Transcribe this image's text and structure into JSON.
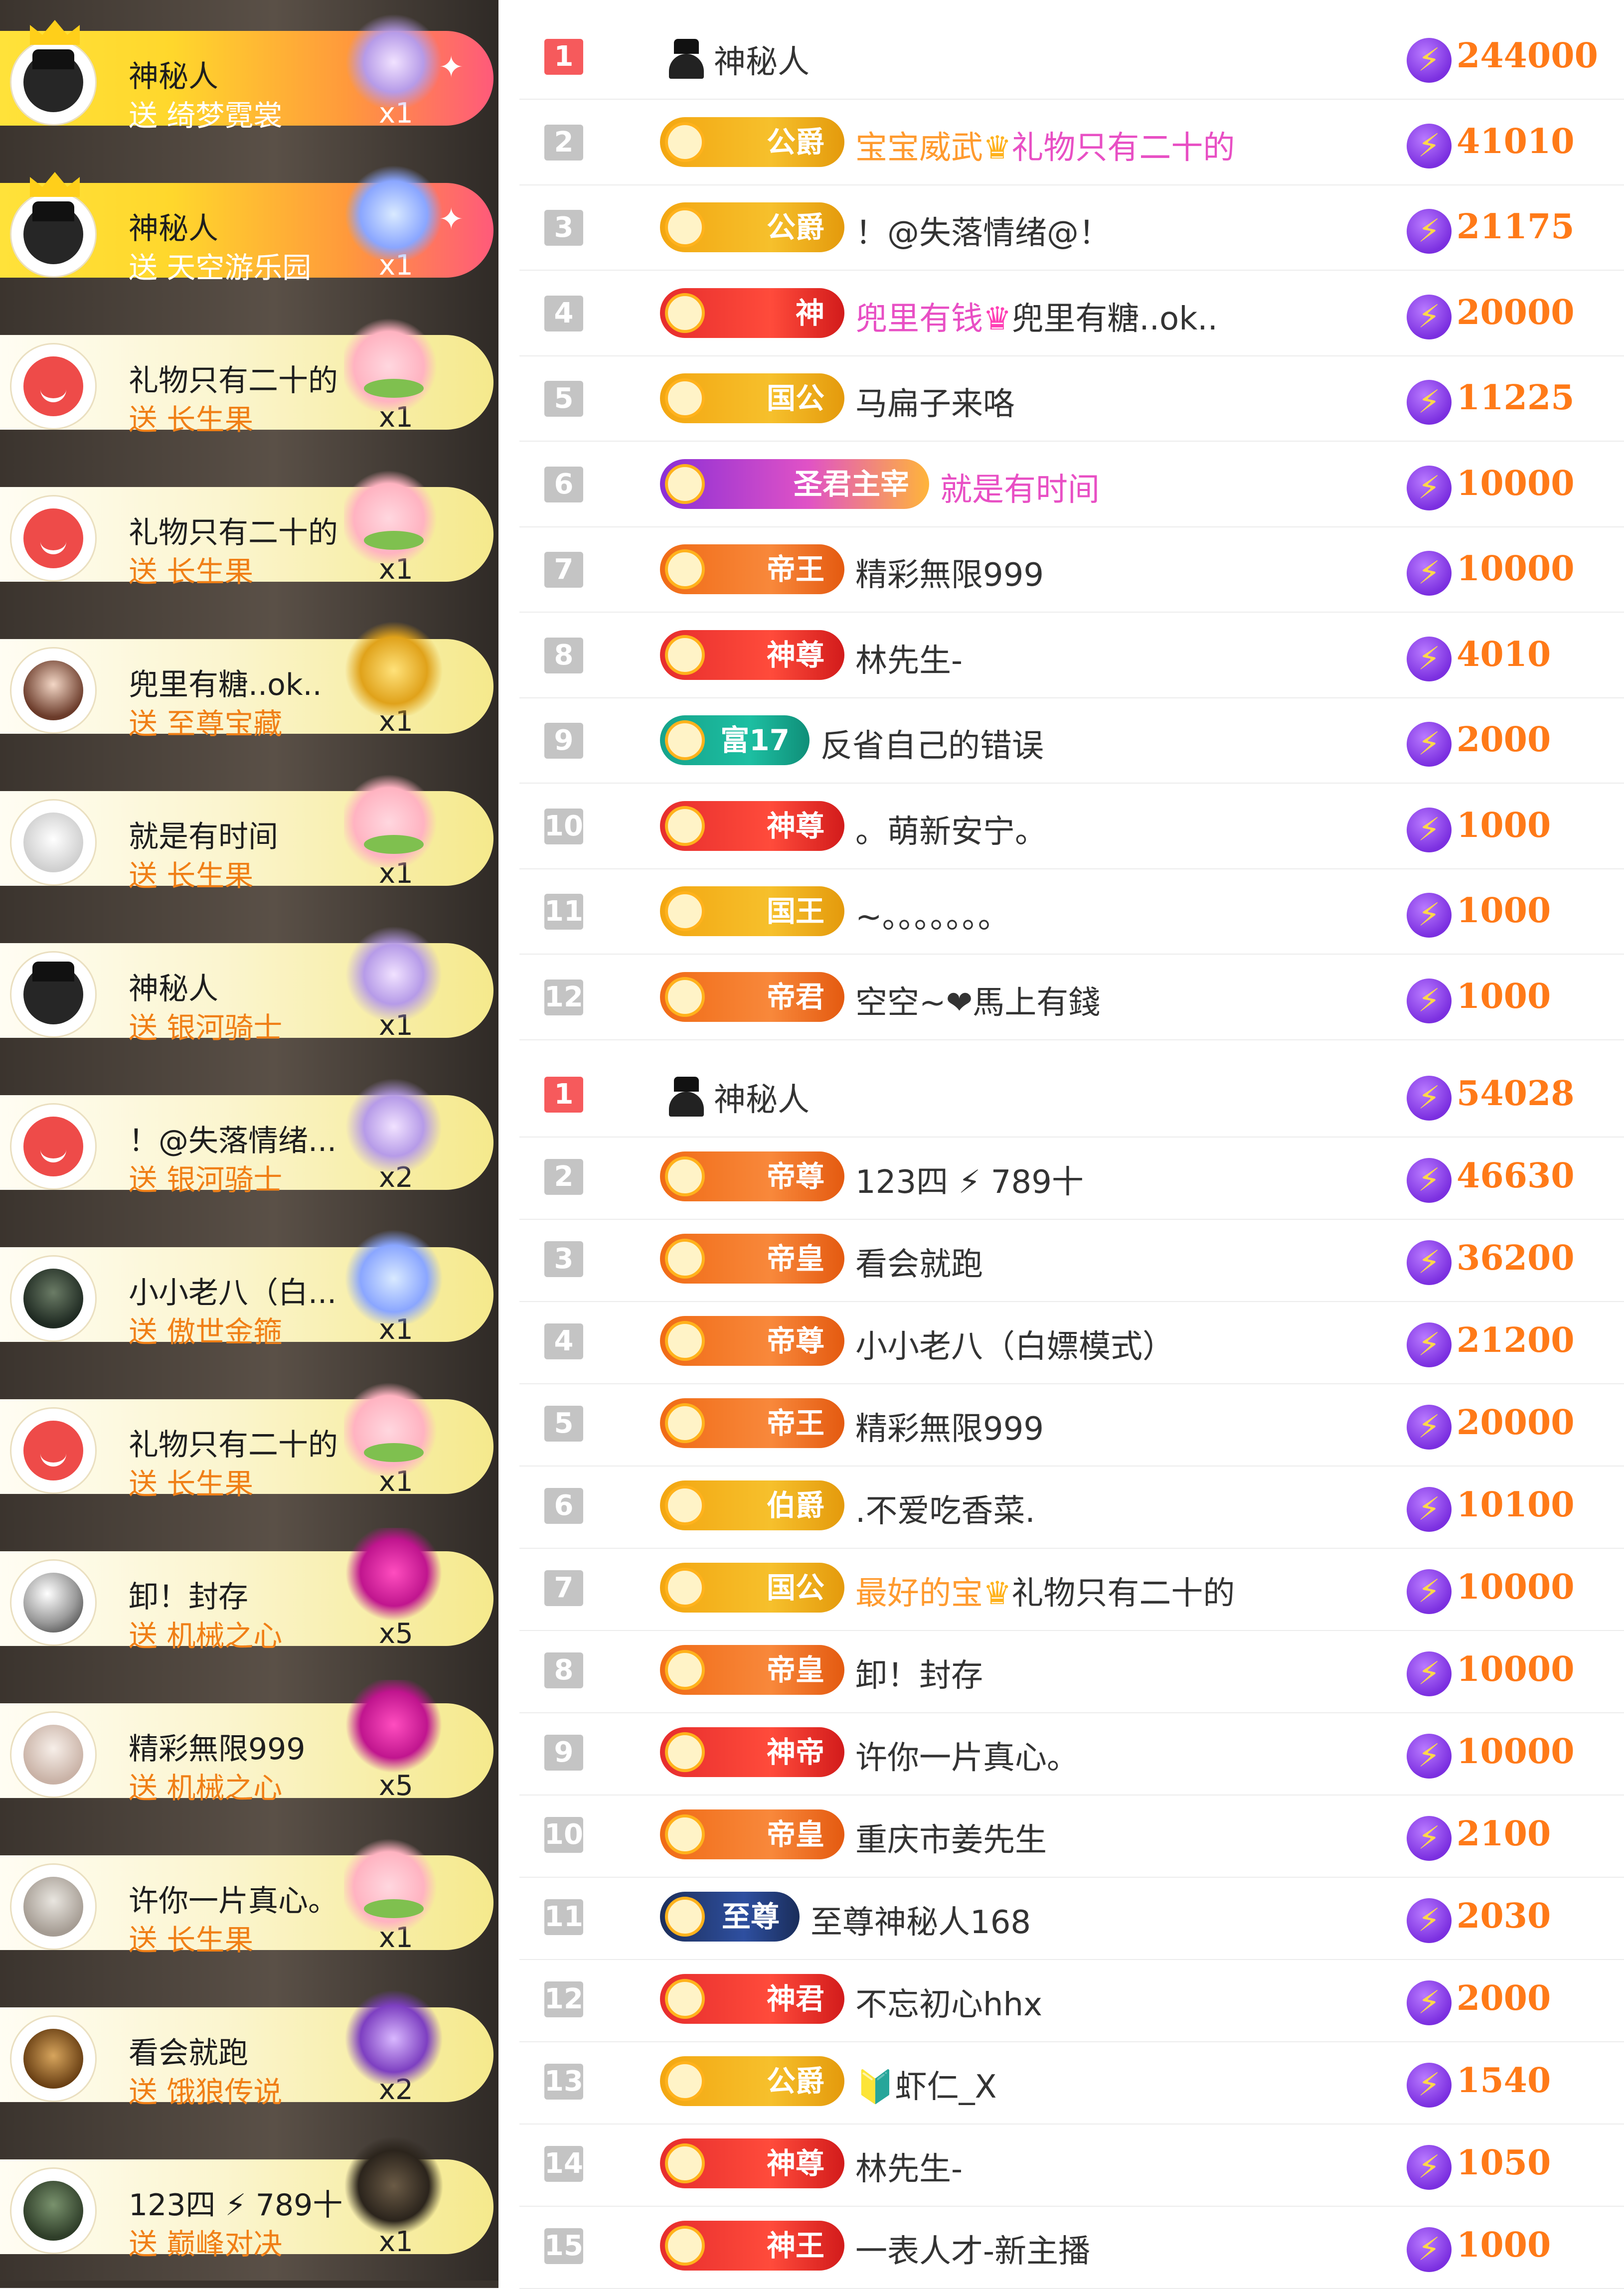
{
  "colors": {
    "accent": "#ff7a18",
    "rank_first": "#f65a5c",
    "rank_other": "#c4c4c4",
    "bolt": "#7b2fe0"
  },
  "feed": [
    {
      "name": "神秘人",
      "gift": "送 绮梦霓裳",
      "count": "x1",
      "top": true,
      "avatar": "grey",
      "gift_icon": "crystal"
    },
    {
      "name": "神秘人",
      "gift": "送 天空游乐园",
      "count": "x1",
      "top": true,
      "avatar": "grey",
      "gift_icon": "blue"
    },
    {
      "name": "礼物只有二十的",
      "gift": "送 长生果",
      "count": "x1",
      "avatar": "red",
      "gift_icon": "peach"
    },
    {
      "name": "礼物只有二十的",
      "gift": "送 长生果",
      "count": "x1",
      "avatar": "red",
      "gift_icon": "peach"
    },
    {
      "name": "兜里有糖..ok..",
      "gift": "送 至尊宝藏",
      "count": "x1",
      "avatar": "photo1",
      "gift_icon": "gold"
    },
    {
      "name": "就是有时间",
      "gift": "送 长生果",
      "count": "x1",
      "avatar": "cartoon",
      "gift_icon": "peach"
    },
    {
      "name": "神秘人",
      "gift": "送 银河骑士",
      "count": "x1",
      "avatar": "grey",
      "gift_icon": "crystal"
    },
    {
      "name": "！@失落情绪...",
      "gift": "送 银河骑士",
      "count": "x2",
      "avatar": "red",
      "gift_icon": "crystal"
    },
    {
      "name": "小小老八（白...",
      "gift": "送 傲世金箍",
      "count": "x1",
      "avatar": "photo2",
      "gift_icon": "blue"
    },
    {
      "name": "礼物只有二十的",
      "gift": "送 长生果",
      "count": "x1",
      "avatar": "red",
      "gift_icon": "peach"
    },
    {
      "name": "卸！封存",
      "gift": "送 机械之心",
      "count": "x5",
      "avatar": "pearl",
      "gift_icon": "heart"
    },
    {
      "name": "精彩無限999",
      "gift": "送 机械之心",
      "count": "x5",
      "avatar": "photo3",
      "gift_icon": "heart"
    },
    {
      "name": "许你一片真心。",
      "gift": "送 长生果",
      "count": "x1",
      "avatar": "photo4",
      "gift_icon": "peach"
    },
    {
      "name": "看会就跑",
      "gift": "送 饿狼传说",
      "count": "x2",
      "avatar": "photo5",
      "gift_icon": "purple"
    },
    {
      "name": "123四 ⚡ 789十",
      "gift": "送 巅峰对决",
      "count": "x1",
      "avatar": "photo6",
      "gift_icon": "dark"
    }
  ],
  "ranking_1": [
    {
      "rank": "1",
      "badge": "",
      "badge_style": "none",
      "spy": true,
      "name_parts": [
        {
          "t": "神秘人",
          "c": ""
        }
      ],
      "score": "244000"
    },
    {
      "rank": "2",
      "badge": "公爵",
      "badge_style": "gold",
      "name_parts": [
        {
          "t": "宝宝威武",
          "c": "hl"
        },
        {
          "t": "♛",
          "c": "crownmini"
        },
        {
          "t": "礼物只有二十的",
          "c": "pk"
        }
      ],
      "score": "41010"
    },
    {
      "rank": "3",
      "badge": "公爵",
      "badge_style": "gold",
      "name_parts": [
        {
          "t": "！@失落情绪@！",
          "c": ""
        }
      ],
      "score": "21175"
    },
    {
      "rank": "4",
      "badge": "神",
      "badge_style": "red",
      "name_parts": [
        {
          "t": "兜里有钱",
          "c": "pk"
        },
        {
          "t": "♛",
          "c": "heartmini"
        },
        {
          "t": "兜里有糖..ok..",
          "c": ""
        }
      ],
      "score": "20000"
    },
    {
      "rank": "5",
      "badge": "国公",
      "badge_style": "gold",
      "name_parts": [
        {
          "t": "马扁子来咯",
          "c": ""
        }
      ],
      "score": "11225"
    },
    {
      "rank": "6",
      "badge": "圣君主宰",
      "badge_style": "purp",
      "name_parts": [
        {
          "t": "就是有时间",
          "c": "pk"
        }
      ],
      "score": "10000"
    },
    {
      "rank": "7",
      "badge": "帝王",
      "badge_style": "orng",
      "name_parts": [
        {
          "t": "精彩無限999",
          "c": ""
        }
      ],
      "score": "10000"
    },
    {
      "rank": "8",
      "badge": "神尊",
      "badge_style": "red",
      "name_parts": [
        {
          "t": "林先生-",
          "c": ""
        }
      ],
      "score": "4010"
    },
    {
      "rank": "9",
      "badge": "富17",
      "badge_style": "teal",
      "name_parts": [
        {
          "t": "反省自己的错误",
          "c": ""
        }
      ],
      "score": "2000"
    },
    {
      "rank": "10",
      "badge": "神尊",
      "badge_style": "red",
      "name_parts": [
        {
          "t": "。萌新安宁。",
          "c": ""
        }
      ],
      "score": "1000"
    },
    {
      "rank": "11",
      "badge": "国王",
      "badge_style": "gold",
      "name_parts": [
        {
          "t": "~。。。。。。。",
          "c": ""
        }
      ],
      "score": "1000"
    },
    {
      "rank": "12",
      "badge": "帝君",
      "badge_style": "orng",
      "name_parts": [
        {
          "t": "空空~❤馬上有錢",
          "c": ""
        }
      ],
      "score": "1000"
    }
  ],
  "ranking_2": [
    {
      "rank": "1",
      "badge": "",
      "badge_style": "none",
      "spy": true,
      "name_parts": [
        {
          "t": "神秘人",
          "c": ""
        }
      ],
      "score": "54028"
    },
    {
      "rank": "2",
      "badge": "帝尊",
      "badge_style": "orng",
      "name_parts": [
        {
          "t": "123四 ⚡ 789十",
          "c": ""
        }
      ],
      "score": "46630"
    },
    {
      "rank": "3",
      "badge": "帝皇",
      "badge_style": "orng",
      "name_parts": [
        {
          "t": "看会就跑",
          "c": ""
        }
      ],
      "score": "36200"
    },
    {
      "rank": "4",
      "badge": "帝尊",
      "badge_style": "orng",
      "name_parts": [
        {
          "t": "小小老八（白嫖模式）",
          "c": ""
        }
      ],
      "score": "21200"
    },
    {
      "rank": "5",
      "badge": "帝王",
      "badge_style": "orng",
      "name_parts": [
        {
          "t": "精彩無限999",
          "c": ""
        }
      ],
      "score": "20000"
    },
    {
      "rank": "6",
      "badge": "伯爵",
      "badge_style": "gold",
      "name_parts": [
        {
          "t": ".不爱吃香菜.",
          "c": ""
        }
      ],
      "score": "10100"
    },
    {
      "rank": "7",
      "badge": "国公",
      "badge_style": "gold",
      "name_parts": [
        {
          "t": "最好的宝",
          "c": "hl"
        },
        {
          "t": "♛",
          "c": "crownmini"
        },
        {
          "t": "礼物只有二十的",
          "c": ""
        }
      ],
      "score": "10000"
    },
    {
      "rank": "8",
      "badge": "帝皇",
      "badge_style": "orng",
      "name_parts": [
        {
          "t": "卸！封存",
          "c": ""
        }
      ],
      "score": "10000"
    },
    {
      "rank": "9",
      "badge": "神帝",
      "badge_style": "red",
      "name_parts": [
        {
          "t": "许你一片真心。",
          "c": ""
        }
      ],
      "score": "10000"
    },
    {
      "rank": "10",
      "badge": "帝皇",
      "badge_style": "orng",
      "name_parts": [
        {
          "t": "重庆市姜先生",
          "c": ""
        }
      ],
      "score": "2100"
    },
    {
      "rank": "11",
      "badge": "至尊",
      "badge_style": "dark",
      "name_parts": [
        {
          "t": "至尊神秘人168",
          "c": ""
        }
      ],
      "score": "2030"
    },
    {
      "rank": "12",
      "badge": "神君",
      "badge_style": "red",
      "name_parts": [
        {
          "t": "不忘初心hhx",
          "c": ""
        }
      ],
      "score": "2000"
    },
    {
      "rank": "13",
      "badge": "公爵",
      "badge_style": "gold",
      "name_parts": [
        {
          "t": "🔰虾仁_X",
          "c": ""
        }
      ],
      "score": "1540"
    },
    {
      "rank": "14",
      "badge": "神尊",
      "badge_style": "red",
      "name_parts": [
        {
          "t": "林先生-",
          "c": ""
        }
      ],
      "score": "1050"
    },
    {
      "rank": "15",
      "badge": "神王",
      "badge_style": "red",
      "name_parts": [
        {
          "t": "一表人才-新主播",
          "c": ""
        }
      ],
      "score": "1000"
    }
  ]
}
